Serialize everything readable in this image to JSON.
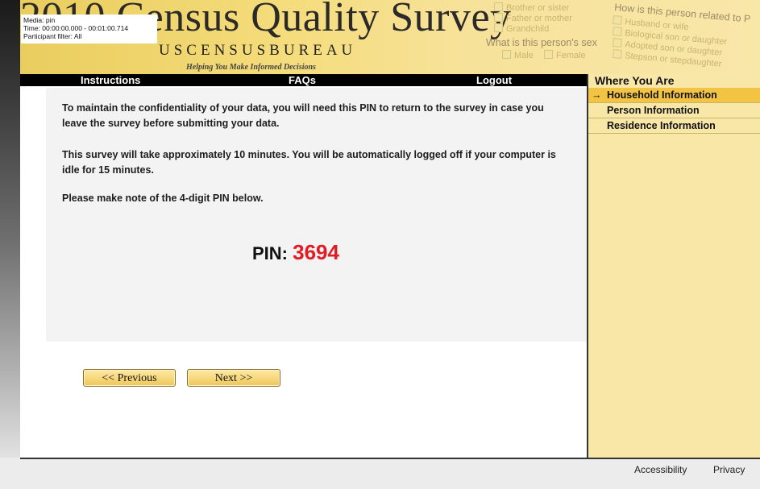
{
  "banner": {
    "title": "2010 Census Quality Survey",
    "bureau": "USCENSUSBUREAU",
    "tagline": "Helping You Make Informed Decisions",
    "deco": {
      "opt_brother": "Brother or sister",
      "opt_father": "Father or mother",
      "opt_grandchild": "Grandchild",
      "question_sex": "What is this person's sex",
      "opt_male": "Male",
      "opt_female": "Female",
      "question_relation": "How is this person related to P",
      "opt_husband": "Husband or wife",
      "opt_bio": "Biological son or daughter",
      "opt_adopted": "Adopted son or daughter",
      "opt_step": "Stepson or stepdaughter"
    }
  },
  "media_info": {
    "media": "Media: pin",
    "time": "Time: 00:00:00.000 - 00:01:00.714",
    "filter": "Participant filter: All"
  },
  "nav": {
    "instructions": "Instructions",
    "faqs": "FAQs",
    "logout": "Logout"
  },
  "content": {
    "para1": "To maintain the confidentiality of your data, you will need this PIN to return to the survey in case you leave the survey before submitting your data.",
    "para2": "This survey will take approximately 10 minutes. You will be automatically logged off if your computer is idle for 15 minutes.",
    "para3": "Please make note of the 4-digit PIN below.",
    "pin_label": "PIN:",
    "pin_value": "3694"
  },
  "buttons": {
    "previous": "<< Previous",
    "next": "Next >>"
  },
  "sidebar": {
    "title": "Where You Are",
    "items": [
      {
        "label": "Household Information",
        "active": true
      },
      {
        "label": "Person Information",
        "active": false
      },
      {
        "label": "Residence Information",
        "active": false
      }
    ]
  },
  "footer": {
    "accessibility": "Accessibility",
    "privacy": "Privacy"
  },
  "colors": {
    "pin": "#e31b23",
    "sidebar_bg": "#f9e7a8",
    "active_item": "#f3c443",
    "nav_bg": "#000000"
  }
}
